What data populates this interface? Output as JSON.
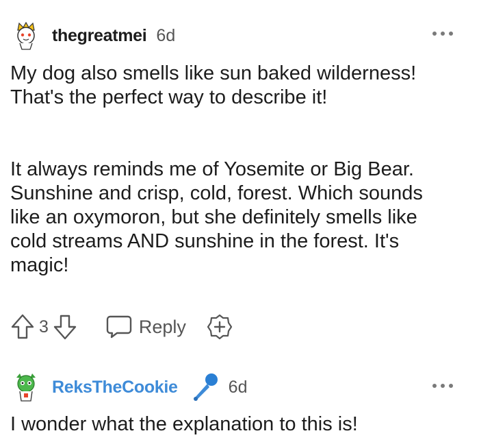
{
  "comments": [
    {
      "username": "thegreatmei",
      "time": "6d",
      "paragraphs": [
        "My dog also smells like sun baked wilderness! That's the perfect way to describe it!",
        "It always reminds me of Yosemite or Big Bear. Sunshine and crisp, cold, forest. Which sounds like an oxymoron, but she definitely smells like cold streams AND sunshine in the forest. It's magic!"
      ],
      "votes": "3",
      "reply_label": "Reply"
    },
    {
      "username": "ReksTheCookie",
      "time": "6d",
      "username_color": "#3e8bd8",
      "flair_icon": "microphone-icon",
      "paragraphs": [
        "I wonder what the explanation to this is!"
      ]
    }
  ]
}
